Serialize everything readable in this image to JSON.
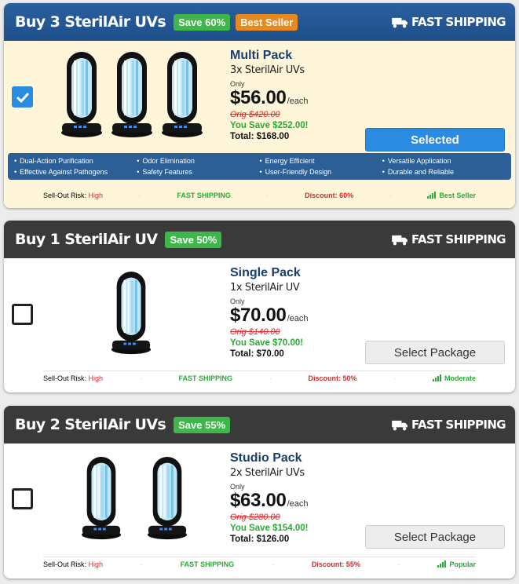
{
  "shipping_label": "FAST SHIPPING",
  "colors": {
    "accent_blue": "#2a8be0",
    "header_blue": "#1e4f8a",
    "header_dark": "#3a3a3a",
    "save_green": "#3fb64a",
    "bestseller_orange": "#e8891e",
    "price_red": "#e0262a"
  },
  "icons": {
    "shipping": "truck-icon",
    "check": "checkmark-icon",
    "rating": "signal-bars-icon"
  },
  "packages": [
    {
      "title": "Buy 3 SterilAir UVs",
      "save_badge": "Save 60%",
      "extra_badge": "Best Seller",
      "name": "Multi Pack",
      "subtitle": "3x SterilAir UVs",
      "only_label": "Only",
      "price": "$56.00",
      "per": "/each",
      "orig": "Orig $420.00",
      "you_save": "You Save $252.00!",
      "total": "Total: $168.00",
      "button": "Selected",
      "selected": true,
      "lamp_count": 3,
      "features": [
        "Dual-Action Purification",
        "Odor Elimination",
        "Energy Efficient",
        "Versatile Application",
        "Effective Against Pathogens",
        "Safety Features",
        "User-Friendly Design",
        "Durable and Reliable"
      ],
      "risk_label": "Sell-Out Risk:",
      "risk_value": "High",
      "shipping": "FAST SHIPPING",
      "discount": "Discount: 60%",
      "popularity": "Best Seller"
    },
    {
      "title": "Buy 1 SterilAir UV",
      "save_badge": "Save 50%",
      "name": "Single Pack",
      "subtitle": "1x SterilAir UV",
      "only_label": "Only",
      "price": "$70.00",
      "per": "/each",
      "orig": "Orig $140.00",
      "you_save": "You Save $70.00!",
      "total": "Total: $70.00",
      "button": "Select Package",
      "selected": false,
      "lamp_count": 1,
      "risk_label": "Sell-Out Risk:",
      "risk_value": "High",
      "shipping": "FAST SHIPPING",
      "discount": "Discount: 50%",
      "popularity": "Moderate"
    },
    {
      "title": "Buy 2 SterilAir UVs",
      "save_badge": "Save 55%",
      "name": "Studio Pack",
      "subtitle": "2x SterilAir UVs",
      "only_label": "Only",
      "price": "$63.00",
      "per": "/each",
      "orig": "Orig $280.00",
      "you_save": "You Save $154.00!",
      "total": "Total: $126.00",
      "button": "Select Package",
      "selected": false,
      "lamp_count": 2,
      "risk_label": "Sell-Out Risk:",
      "risk_value": "High",
      "shipping": "FAST SHIPPING",
      "discount": "Discount: 55%",
      "popularity": "Popular"
    }
  ]
}
